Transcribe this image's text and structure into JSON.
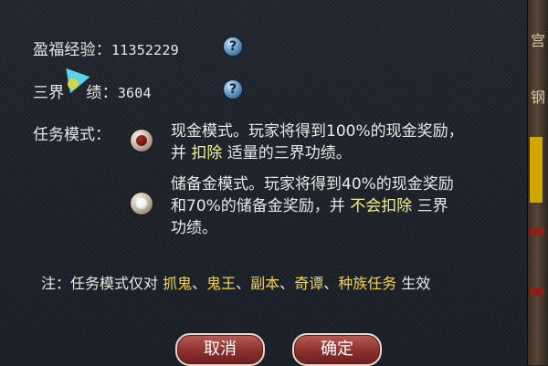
{
  "stats": {
    "experience": {
      "label": "盈福经验：",
      "value": "11352229",
      "help": "?"
    },
    "merit": {
      "label_start": "三界",
      "label_end": "绩：",
      "value": "3604",
      "help": "?"
    }
  },
  "mode": {
    "label": "任务模式：",
    "options": [
      {
        "selected": false,
        "line1": "现金模式。玩家将得到100%的现金奖励，",
        "line2_pre": "并 ",
        "line2_hl": "扣除",
        "line2_post": " 适量的三界功绩。"
      },
      {
        "selected": true,
        "line1": "储备金模式。玩家将得到40%的现金奖励",
        "line2_pre": "和70%的储备金奖励，并 ",
        "line2_hl": "不会扣除",
        "line2_post": " 三界",
        "line3": "功绩。"
      }
    ]
  },
  "note": {
    "prefix": "注：任务模式仅对 ",
    "items": [
      "抓鬼",
      "鬼王",
      "副本",
      "奇谭",
      "种族任务"
    ],
    "separator": "、",
    "suffix": " 生效"
  },
  "buttons": {
    "cancel": "取消",
    "confirm": "确定"
  },
  "sidebar": {
    "glyphs": [
      "宫",
      "钢"
    ]
  },
  "colors": {
    "highlight": "#f4f08a",
    "task_names": "#f3d34e",
    "button": "#8c2f2e"
  }
}
